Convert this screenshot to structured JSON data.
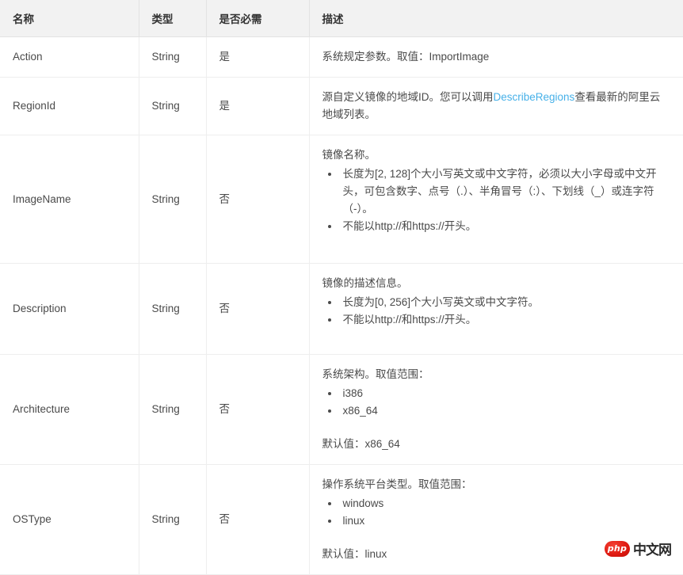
{
  "table": {
    "columns": [
      {
        "key": "name",
        "label": "名称"
      },
      {
        "key": "type",
        "label": "类型"
      },
      {
        "key": "required",
        "label": "是否必需"
      },
      {
        "key": "description",
        "label": "描述"
      }
    ],
    "rows": [
      {
        "name": "Action",
        "type": "String",
        "required": "是",
        "desc_intro": "系统规定参数。取值：ImportImage",
        "desc_bullets": [],
        "desc_default": ""
      },
      {
        "name": "RegionId",
        "type": "String",
        "required": "是",
        "desc_intro_pre": "源自定义镜像的地域ID。您可以调用",
        "desc_link": "DescribeRegions",
        "desc_intro_post": "查看最新的阿里云地域列表。",
        "desc_bullets": [],
        "desc_default": ""
      },
      {
        "name": "ImageName",
        "type": "String",
        "required": "否",
        "desc_intro": "镜像名称。",
        "desc_bullets": [
          "长度为[2, 128]个大小写英文或中文字符，必须以大小字母或中文开头，可包含数字、点号（.）、半角冒号（:）、下划线（_）或连字符（-）。",
          "不能以http://和https://开头。"
        ],
        "desc_default": ""
      },
      {
        "name": "Description",
        "type": "String",
        "required": "否",
        "desc_intro": "镜像的描述信息。",
        "desc_bullets": [
          "长度为[0, 256]个大小写英文或中文字符。",
          "不能以http://和https://开头。"
        ],
        "desc_default": ""
      },
      {
        "name": "Architecture",
        "type": "String",
        "required": "否",
        "desc_intro": "系统架构。取值范围：",
        "desc_bullets": [
          "i386",
          "x86_64"
        ],
        "desc_default": "默认值：x86_64"
      },
      {
        "name": "OSType",
        "type": "String",
        "required": "否",
        "desc_intro": "操作系统平台类型。取值范围：",
        "desc_bullets": [
          "windows",
          "linux"
        ],
        "desc_default": "默认值：linux"
      }
    ]
  },
  "watermark": {
    "badge": "php",
    "text": "中文网"
  },
  "colors": {
    "link": "#46b0e8",
    "header_bg": "#f2f2f2",
    "border": "#eeeeee",
    "text": "#4a4a4a"
  }
}
